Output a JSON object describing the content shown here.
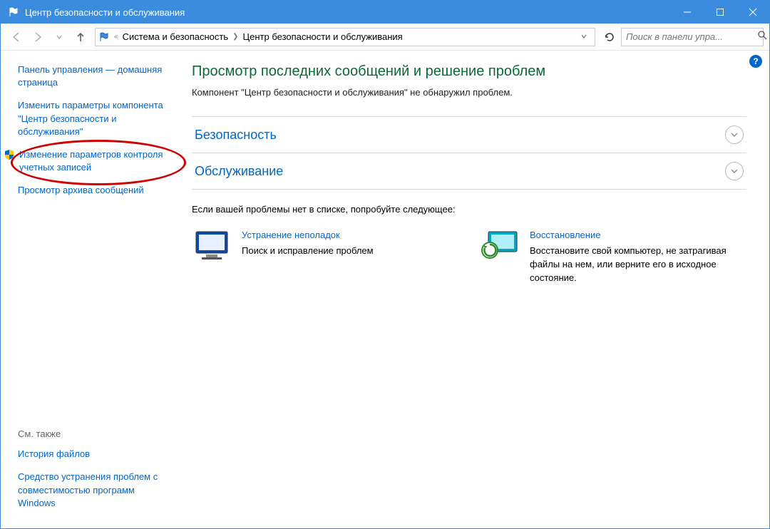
{
  "window": {
    "title": "Центр безопасности и обслуживания"
  },
  "breadcrumb": {
    "prefix": "«",
    "item1": "Система и безопасность",
    "item2": "Центр безопасности и обслуживания"
  },
  "search": {
    "placeholder": "Поиск в панели упра..."
  },
  "sidebar": {
    "items": [
      "Панель управления — домашняя страница",
      "Изменить параметры компонента \"Центр безопасности и обслуживания\"",
      "Изменение параметров контроля учетных записей",
      "Просмотр архива сообщений"
    ],
    "see_also_title": "См. также",
    "see_also": [
      "История файлов",
      "Средство устранения проблем с совместимостью программ Windows"
    ]
  },
  "main": {
    "heading": "Просмотр последних сообщений и решение проблем",
    "subtitle": "Компонент \"Центр безопасности и обслуживания\" не обнаружил проблем.",
    "sections": [
      {
        "title": "Безопасность"
      },
      {
        "title": "Обслуживание"
      }
    ],
    "try_also": "Если вашей проблемы нет в списке, попробуйте следующее:",
    "cards": [
      {
        "title": "Устранение неполадок",
        "desc": "Поиск и исправление проблем"
      },
      {
        "title": "Восстановление",
        "desc": "Восстановите свой компьютер, не затрагивая файлы на нем, или верните его в исходное состояние."
      }
    ]
  }
}
